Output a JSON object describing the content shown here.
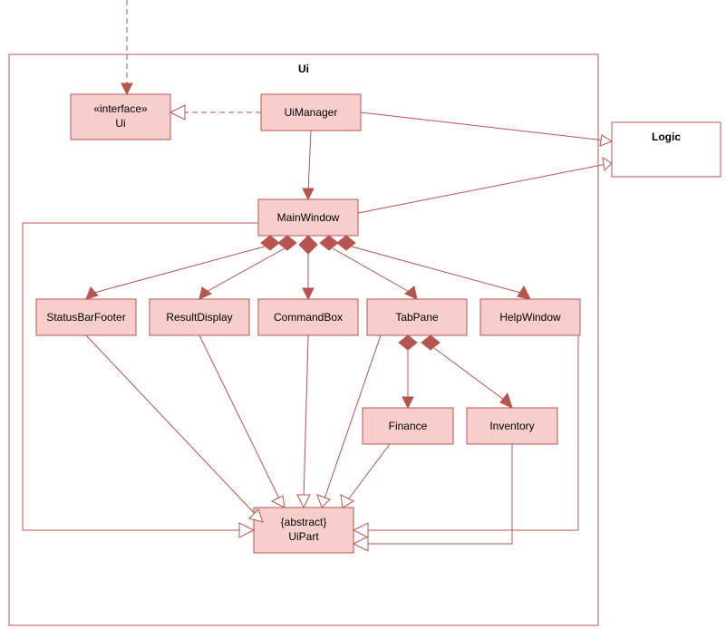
{
  "package": {
    "title": "Ui"
  },
  "external": {
    "logic": "Logic"
  },
  "nodes": {
    "uiInterface": {
      "stereotype": "«interface»",
      "name": "Ui"
    },
    "uiManager": "UiManager",
    "mainWindow": "MainWindow",
    "statusBarFooter": "StatusBarFooter",
    "resultDisplay": "ResultDisplay",
    "commandBox": "CommandBox",
    "tabPane": "TabPane",
    "helpWindow": "HelpWindow",
    "finance": "Finance",
    "inventory": "Inventory",
    "uiPart": {
      "stereotype": "{abstract}",
      "name": "UiPart"
    }
  },
  "chart_data": {
    "type": "uml-class-diagram",
    "package": "Ui",
    "classes": [
      {
        "id": "Ui",
        "stereotype": "interface"
      },
      {
        "id": "UiManager"
      },
      {
        "id": "MainWindow"
      },
      {
        "id": "StatusBarFooter"
      },
      {
        "id": "ResultDisplay"
      },
      {
        "id": "CommandBox"
      },
      {
        "id": "TabPane"
      },
      {
        "id": "HelpWindow"
      },
      {
        "id": "Finance"
      },
      {
        "id": "Inventory"
      },
      {
        "id": "UiPart",
        "stereotype": "abstract"
      },
      {
        "id": "Logic",
        "external": true
      }
    ],
    "relations": [
      {
        "from": "(external)",
        "to": "Ui",
        "type": "dependency"
      },
      {
        "from": "UiManager",
        "to": "Ui",
        "type": "realization"
      },
      {
        "from": "UiManager",
        "to": "MainWindow",
        "type": "association-directed"
      },
      {
        "from": "UiManager",
        "to": "Logic",
        "type": "association-directed"
      },
      {
        "from": "MainWindow",
        "to": "Logic",
        "type": "association-directed"
      },
      {
        "from": "MainWindow",
        "to": "StatusBarFooter",
        "type": "composition"
      },
      {
        "from": "MainWindow",
        "to": "ResultDisplay",
        "type": "composition"
      },
      {
        "from": "MainWindow",
        "to": "CommandBox",
        "type": "composition"
      },
      {
        "from": "MainWindow",
        "to": "TabPane",
        "type": "composition"
      },
      {
        "from": "MainWindow",
        "to": "HelpWindow",
        "type": "composition"
      },
      {
        "from": "TabPane",
        "to": "Finance",
        "type": "composition"
      },
      {
        "from": "TabPane",
        "to": "Inventory",
        "type": "composition"
      },
      {
        "from": "MainWindow",
        "to": "UiPart",
        "type": "generalization"
      },
      {
        "from": "StatusBarFooter",
        "to": "UiPart",
        "type": "generalization"
      },
      {
        "from": "ResultDisplay",
        "to": "UiPart",
        "type": "generalization"
      },
      {
        "from": "CommandBox",
        "to": "UiPart",
        "type": "generalization"
      },
      {
        "from": "TabPane",
        "to": "UiPart",
        "type": "generalization"
      },
      {
        "from": "HelpWindow",
        "to": "UiPart",
        "type": "generalization"
      },
      {
        "from": "Finance",
        "to": "UiPart",
        "type": "generalization"
      },
      {
        "from": "Inventory",
        "to": "UiPart",
        "type": "generalization"
      }
    ]
  }
}
